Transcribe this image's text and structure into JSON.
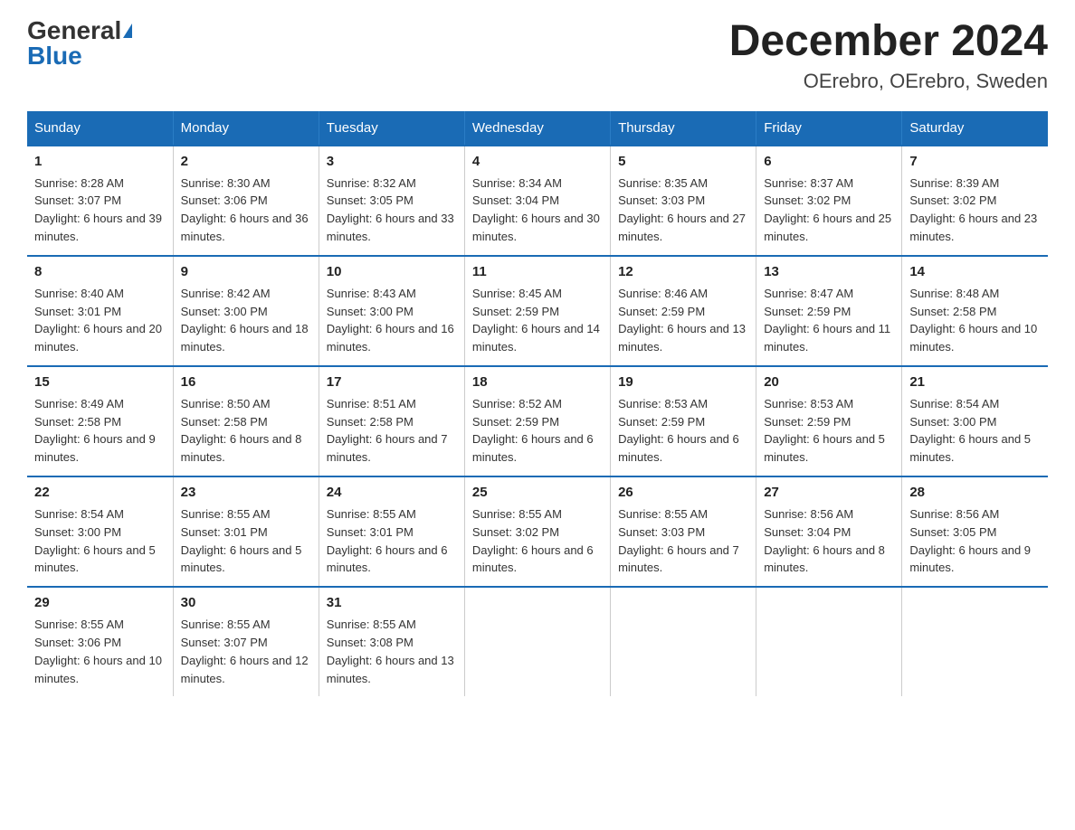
{
  "logo": {
    "general": "General",
    "blue": "Blue"
  },
  "title": "December 2024",
  "subtitle": "OErebro, OErebro, Sweden",
  "days_of_week": [
    "Sunday",
    "Monday",
    "Tuesday",
    "Wednesday",
    "Thursday",
    "Friday",
    "Saturday"
  ],
  "weeks": [
    [
      {
        "num": "1",
        "sunrise": "8:28 AM",
        "sunset": "3:07 PM",
        "daylight": "6 hours and 39 minutes."
      },
      {
        "num": "2",
        "sunrise": "8:30 AM",
        "sunset": "3:06 PM",
        "daylight": "6 hours and 36 minutes."
      },
      {
        "num": "3",
        "sunrise": "8:32 AM",
        "sunset": "3:05 PM",
        "daylight": "6 hours and 33 minutes."
      },
      {
        "num": "4",
        "sunrise": "8:34 AM",
        "sunset": "3:04 PM",
        "daylight": "6 hours and 30 minutes."
      },
      {
        "num": "5",
        "sunrise": "8:35 AM",
        "sunset": "3:03 PM",
        "daylight": "6 hours and 27 minutes."
      },
      {
        "num": "6",
        "sunrise": "8:37 AM",
        "sunset": "3:02 PM",
        "daylight": "6 hours and 25 minutes."
      },
      {
        "num": "7",
        "sunrise": "8:39 AM",
        "sunset": "3:02 PM",
        "daylight": "6 hours and 23 minutes."
      }
    ],
    [
      {
        "num": "8",
        "sunrise": "8:40 AM",
        "sunset": "3:01 PM",
        "daylight": "6 hours and 20 minutes."
      },
      {
        "num": "9",
        "sunrise": "8:42 AM",
        "sunset": "3:00 PM",
        "daylight": "6 hours and 18 minutes."
      },
      {
        "num": "10",
        "sunrise": "8:43 AM",
        "sunset": "3:00 PM",
        "daylight": "6 hours and 16 minutes."
      },
      {
        "num": "11",
        "sunrise": "8:45 AM",
        "sunset": "2:59 PM",
        "daylight": "6 hours and 14 minutes."
      },
      {
        "num": "12",
        "sunrise": "8:46 AM",
        "sunset": "2:59 PM",
        "daylight": "6 hours and 13 minutes."
      },
      {
        "num": "13",
        "sunrise": "8:47 AM",
        "sunset": "2:59 PM",
        "daylight": "6 hours and 11 minutes."
      },
      {
        "num": "14",
        "sunrise": "8:48 AM",
        "sunset": "2:58 PM",
        "daylight": "6 hours and 10 minutes."
      }
    ],
    [
      {
        "num": "15",
        "sunrise": "8:49 AM",
        "sunset": "2:58 PM",
        "daylight": "6 hours and 9 minutes."
      },
      {
        "num": "16",
        "sunrise": "8:50 AM",
        "sunset": "2:58 PM",
        "daylight": "6 hours and 8 minutes."
      },
      {
        "num": "17",
        "sunrise": "8:51 AM",
        "sunset": "2:58 PM",
        "daylight": "6 hours and 7 minutes."
      },
      {
        "num": "18",
        "sunrise": "8:52 AM",
        "sunset": "2:59 PM",
        "daylight": "6 hours and 6 minutes."
      },
      {
        "num": "19",
        "sunrise": "8:53 AM",
        "sunset": "2:59 PM",
        "daylight": "6 hours and 6 minutes."
      },
      {
        "num": "20",
        "sunrise": "8:53 AM",
        "sunset": "2:59 PM",
        "daylight": "6 hours and 5 minutes."
      },
      {
        "num": "21",
        "sunrise": "8:54 AM",
        "sunset": "3:00 PM",
        "daylight": "6 hours and 5 minutes."
      }
    ],
    [
      {
        "num": "22",
        "sunrise": "8:54 AM",
        "sunset": "3:00 PM",
        "daylight": "6 hours and 5 minutes."
      },
      {
        "num": "23",
        "sunrise": "8:55 AM",
        "sunset": "3:01 PM",
        "daylight": "6 hours and 5 minutes."
      },
      {
        "num": "24",
        "sunrise": "8:55 AM",
        "sunset": "3:01 PM",
        "daylight": "6 hours and 6 minutes."
      },
      {
        "num": "25",
        "sunrise": "8:55 AM",
        "sunset": "3:02 PM",
        "daylight": "6 hours and 6 minutes."
      },
      {
        "num": "26",
        "sunrise": "8:55 AM",
        "sunset": "3:03 PM",
        "daylight": "6 hours and 7 minutes."
      },
      {
        "num": "27",
        "sunrise": "8:56 AM",
        "sunset": "3:04 PM",
        "daylight": "6 hours and 8 minutes."
      },
      {
        "num": "28",
        "sunrise": "8:56 AM",
        "sunset": "3:05 PM",
        "daylight": "6 hours and 9 minutes."
      }
    ],
    [
      {
        "num": "29",
        "sunrise": "8:55 AM",
        "sunset": "3:06 PM",
        "daylight": "6 hours and 10 minutes."
      },
      {
        "num": "30",
        "sunrise": "8:55 AM",
        "sunset": "3:07 PM",
        "daylight": "6 hours and 12 minutes."
      },
      {
        "num": "31",
        "sunrise": "8:55 AM",
        "sunset": "3:08 PM",
        "daylight": "6 hours and 13 minutes."
      },
      {
        "num": "",
        "sunrise": "",
        "sunset": "",
        "daylight": ""
      },
      {
        "num": "",
        "sunrise": "",
        "sunset": "",
        "daylight": ""
      },
      {
        "num": "",
        "sunrise": "",
        "sunset": "",
        "daylight": ""
      },
      {
        "num": "",
        "sunrise": "",
        "sunset": "",
        "daylight": ""
      }
    ]
  ]
}
